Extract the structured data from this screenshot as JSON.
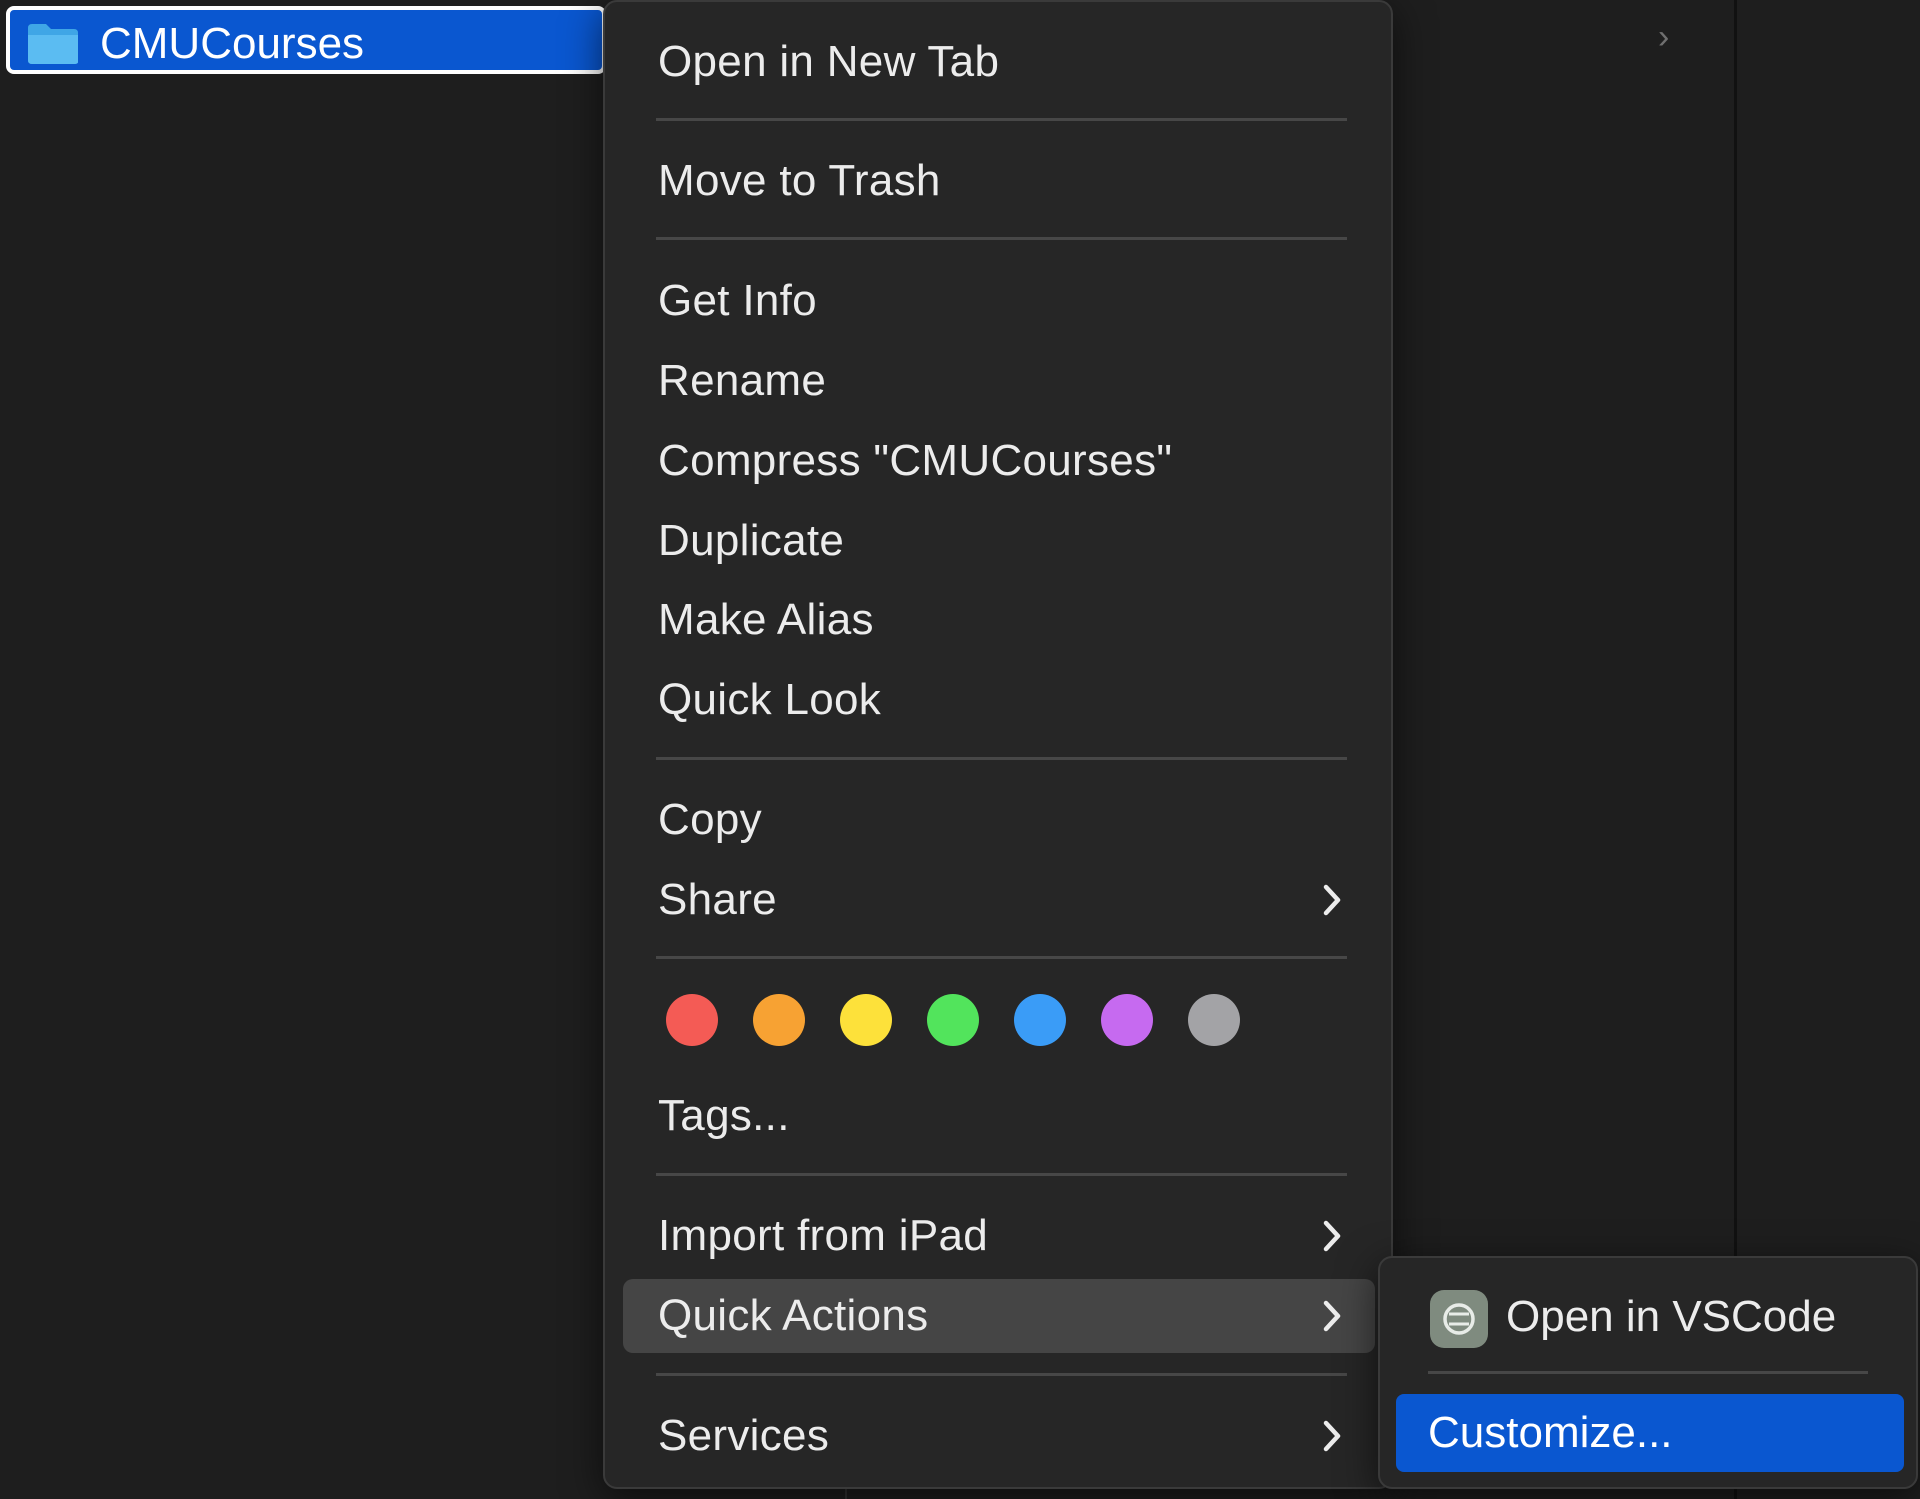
{
  "finder": {
    "selected_item": {
      "name": "CMUCourses",
      "icon": "folder-icon"
    },
    "background_chevron": "›"
  },
  "context_menu": {
    "groups": [
      [
        {
          "label": "Open in New Tab",
          "submenu": false
        }
      ],
      [
        {
          "label": "Move to Trash",
          "submenu": false
        }
      ],
      [
        {
          "label": "Get Info",
          "submenu": false
        },
        {
          "label": "Rename",
          "submenu": false
        },
        {
          "label": "Compress \"CMUCourses\"",
          "submenu": false
        },
        {
          "label": "Duplicate",
          "submenu": false
        },
        {
          "label": "Make Alias",
          "submenu": false
        },
        {
          "label": "Quick Look",
          "submenu": false
        }
      ],
      [
        {
          "label": "Copy",
          "submenu": false
        },
        {
          "label": "Share",
          "submenu": true
        }
      ],
      [
        {
          "label": "Tags...",
          "submenu": false
        }
      ],
      [
        {
          "label": "Import from iPad",
          "submenu": true
        },
        {
          "label": "Quick Actions",
          "submenu": true,
          "highlighted": true
        }
      ],
      [
        {
          "label": "Services",
          "submenu": true
        }
      ]
    ],
    "tag_colors": [
      "#f45b55",
      "#f7a233",
      "#fde13a",
      "#52e45c",
      "#3a9cf7",
      "#c66af0",
      "#a3a3a6"
    ],
    "highlight_color": "#454545"
  },
  "submenu": {
    "items": [
      {
        "label": "Open in VSCode",
        "icon": "vscode-icon"
      },
      {
        "label": "Customize...",
        "active": true
      }
    ],
    "accent": "#0a57d0"
  }
}
